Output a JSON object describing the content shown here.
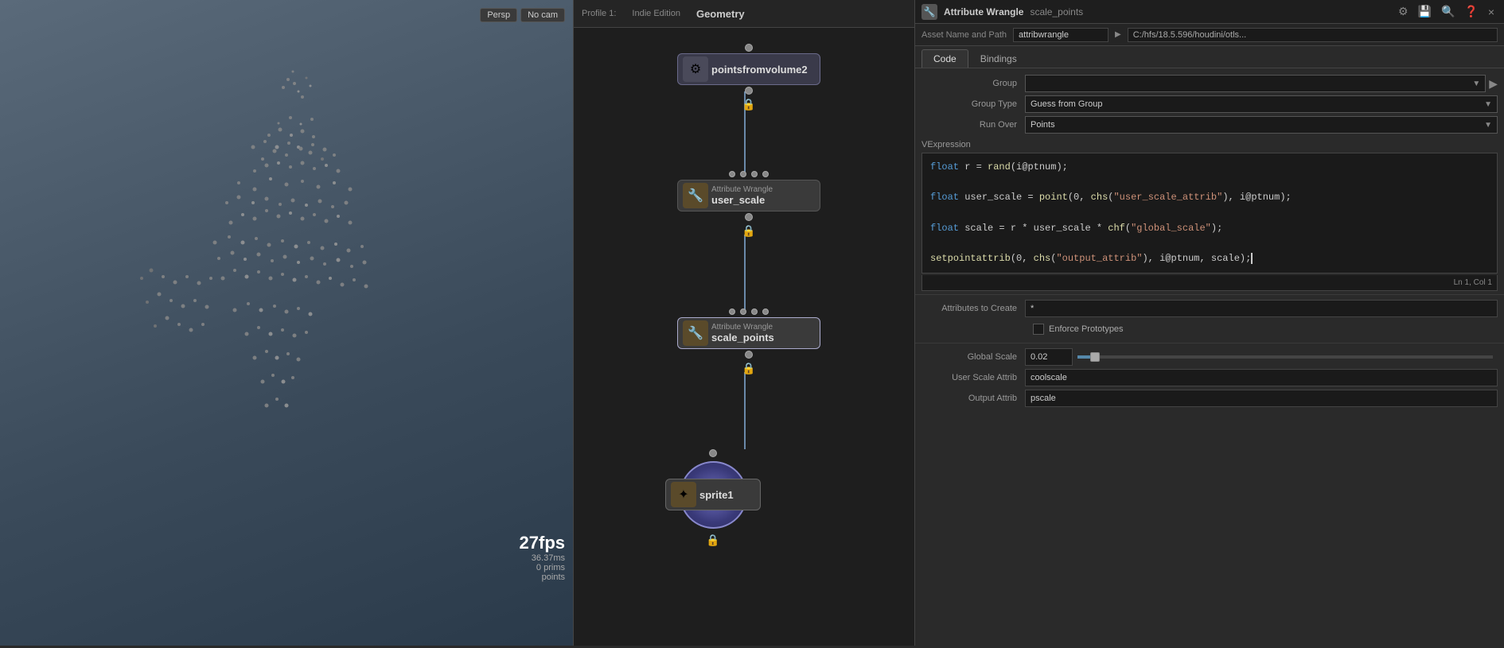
{
  "viewport": {
    "mode": "Persp",
    "camera": "No cam",
    "stats": {
      "fps": "27fps",
      "ms": "36.37ms",
      "prims_label": "prims",
      "prims_count": "0",
      "points_label": "points"
    }
  },
  "node_graph": {
    "profile_label": "Profile 1:",
    "edition": "Indie Edition",
    "type": "Geometry",
    "nodes": [
      {
        "id": "node1",
        "type_label": "",
        "name": "pointsfromvolume2",
        "icon": "⚙"
      },
      {
        "id": "node2",
        "type_label": "Attribute Wrangle",
        "name": "user_scale",
        "icon": "🔧"
      },
      {
        "id": "node3",
        "type_label": "Attribute Wrangle",
        "name": "scale_points",
        "icon": "🔧"
      },
      {
        "id": "node4",
        "type_label": "",
        "name": "sprite1",
        "icon": "✦"
      }
    ]
  },
  "right_panel": {
    "header": {
      "icon": "🔧",
      "node_type": "Attribute Wrangle",
      "node_name": "scale_points",
      "actions": [
        "⚙",
        "💾",
        "🔍",
        "❓",
        "×"
      ]
    },
    "asset_name_row": {
      "label": "Asset Name and Path",
      "input_value": "attribwrangle",
      "path_value": "C:/hfs/18.5.596/houdini/otls..."
    },
    "tabs": [
      "Code",
      "Bindings"
    ],
    "active_tab": "Code",
    "properties": {
      "group_label": "Group",
      "group_value": "",
      "group_type_label": "Group Type",
      "group_type_value": "Guess from Group",
      "run_over_label": "Run Over",
      "run_over_value": "Points",
      "vexpression_label": "VExpression",
      "code_lines": [
        "float r = rand(i@ptnum);",
        "",
        "float user_scale = point(0, chs(\"user_scale_attrib\"), i@ptnum);",
        "",
        "float scale = r * user_scale * chf(\"global_scale\");",
        "",
        "setpointattrib(0, chs(\"output_attrib\"), i@ptnum, scale);"
      ],
      "statusbar_text": "Ln 1, Col 1",
      "attrs_to_create_label": "Attributes to Create",
      "attrs_to_create_value": "*",
      "enforce_prototypes_label": "Enforce Prototypes",
      "enforce_prototypes_checked": false,
      "global_scale_label": "Global Scale",
      "global_scale_value": "0.02",
      "user_scale_attrib_label": "User Scale Attrib",
      "user_scale_attrib_value": "coolscale",
      "output_attrib_label": "Output Attrib",
      "output_attrib_value": "pscale"
    }
  }
}
